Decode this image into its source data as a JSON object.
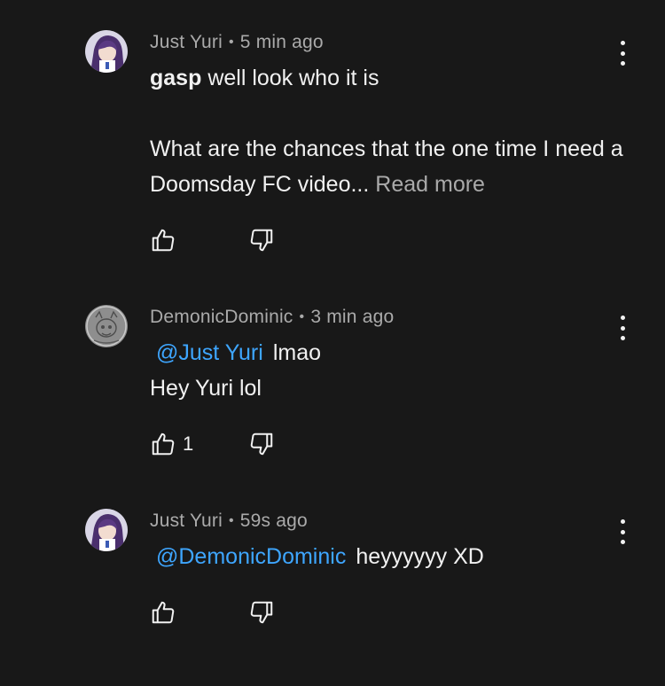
{
  "comments": [
    {
      "author": "Just Yuri",
      "time": "5 min ago",
      "avatar_icon": "anime-girl-avatar",
      "bold_text": "gasp",
      "text_line1": "well look who it is",
      "text_para2": "What are the chances that the one time I need a Doomsday FC video...",
      "read_more": "Read more",
      "likes": ""
    },
    {
      "author": "DemonicDominic",
      "time": "3 min ago",
      "avatar_icon": "grey-sketch-avatar",
      "mention": "@Just Yuri",
      "text_line1": "lmao",
      "text_line2": "Hey Yuri lol",
      "likes": "1"
    },
    {
      "author": "Just Yuri",
      "time": "59s ago",
      "avatar_icon": "anime-girl-avatar",
      "mention": "@DemonicDominic",
      "text_line1": "heyyyyyy XD",
      "likes": ""
    }
  ],
  "separator": "•",
  "colors": {
    "background": "#181818",
    "text": "#f1f1f1",
    "meta": "#aaaaaa",
    "mention": "#3ea6ff"
  }
}
